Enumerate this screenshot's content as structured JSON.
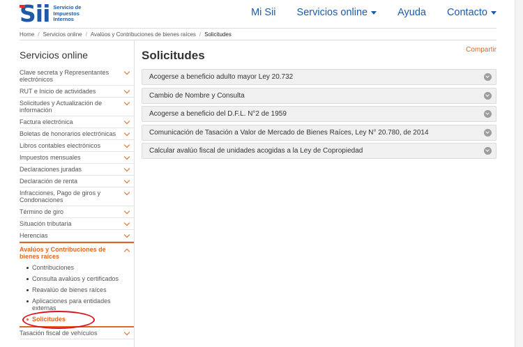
{
  "header": {
    "logo_mark": "Sii",
    "logo_lines": [
      "Servicio de",
      "Impuestos",
      "Internos"
    ],
    "nav": [
      {
        "label": "Mi Sii",
        "has_dropdown": false
      },
      {
        "label": "Servicios online",
        "has_dropdown": true
      },
      {
        "label": "Ayuda",
        "has_dropdown": false
      },
      {
        "label": "Contacto",
        "has_dropdown": true
      }
    ]
  },
  "breadcrumb": [
    "Home",
    "Servicios online",
    "Avalúos y Contribuciones de bienes raíces",
    "Solicitudes"
  ],
  "sidebar": {
    "title": "Servicios online",
    "items": [
      "Clave secreta y Representantes electrónicos",
      "RUT e Inicio de actividades",
      "Solicitudes y Actualización de información",
      "Factura electrónica",
      "Boletas de honorarios electrónicas",
      "Libros contables electrónicos",
      "Impuestos mensuales",
      "Declaraciones juradas",
      "Declaración de renta",
      "Infracciones, Pago de giros y Condonaciones",
      "Término de giro",
      "Situación tributaria",
      "Herencias"
    ],
    "open_item": "Avalúos y Contribuciones de bienes raíces",
    "sub_items": [
      "Contribuciones",
      "Consulta avalúos y certificados",
      "Reavalúo de bienes raíces",
      "Aplicaciones para entidades externas",
      "Solicitudes"
    ],
    "after_items": [
      "Tasación fiscal de vehículos"
    ]
  },
  "main": {
    "title": "Solicitudes",
    "share": "Compartir",
    "accordion": [
      "Acogerse a beneficio adulto mayor Ley 20.732",
      "Cambio de Nombre y Consulta",
      "Acogerse a beneficio del D.F.L. N°2 de 1959",
      "Comunicación de Tasación a Valor de Mercado de Bienes Raíces, Ley N° 20.780, de 2014",
      "Calcular avalúo fiscal de unidades acogidas a la Ley de Copropiedad"
    ]
  },
  "colors": {
    "brand_blue": "#1e5aa8",
    "accent_orange": "#e2661f",
    "ring_red": "#d8141e"
  }
}
